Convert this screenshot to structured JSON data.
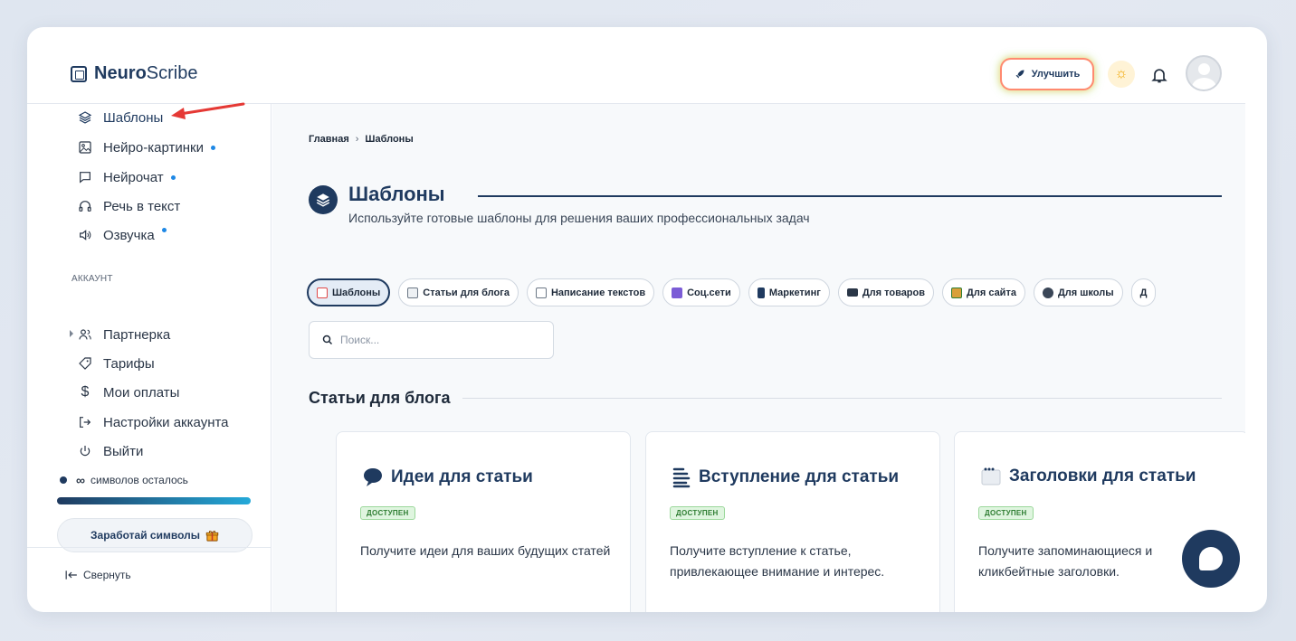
{
  "header": {
    "logo_bold": "Neuro",
    "logo_rest": "Scribe",
    "upgrade_label": "Улучшить"
  },
  "sidebar": {
    "items": [
      {
        "label": "Шаблоны",
        "icon": "layers-icon"
      },
      {
        "label": "Нейро-картинки",
        "icon": "image-icon"
      },
      {
        "label": "Нейрочат",
        "icon": "chat-bubble-icon"
      },
      {
        "label": "Речь в текст",
        "icon": "headphones-icon"
      },
      {
        "label": "Озвучка",
        "icon": "speaker-icon"
      }
    ],
    "account_label": "АККАУНТ",
    "account_items": [
      {
        "label": "Партнерка",
        "icon": "users-icon"
      },
      {
        "label": "Тарифы",
        "icon": "tag-icon"
      },
      {
        "label": "Мои оплаты",
        "icon": "dollar-icon"
      },
      {
        "label": "Настройки аккаунта",
        "icon": "settings-arrow-icon"
      },
      {
        "label": "Выйти",
        "icon": "power-icon"
      }
    ],
    "credits_symbol": "∞",
    "credits_text": "символов осталось",
    "credits_fill": 1.0,
    "earn_label": "Заработай символы",
    "collapse_label": "Свернуть"
  },
  "main": {
    "breadcrumb": [
      "Главная",
      "Шаблоны"
    ],
    "breadcrumb_sep": "›",
    "title": "Шаблоны",
    "subtitle": "Используйте готовые шаблоны для решения ваших профессиональных задач",
    "chips": [
      {
        "label": "Шаблоны",
        "active": true,
        "color": "#e04848"
      },
      {
        "label": "Статьи для блога",
        "color": "#6b7785"
      },
      {
        "label": "Написание текстов",
        "color": "#6b7785"
      },
      {
        "label": "Соц.сети",
        "color": "#7b5cd6"
      },
      {
        "label": "Маркетинг",
        "color": "#1f3a5f"
      },
      {
        "label": "Для товаров",
        "color": "#2a3647"
      },
      {
        "label": "Для сайта",
        "color": "#d9a03a"
      },
      {
        "label": "Для школы",
        "color": "#3a4657"
      },
      {
        "label": "Д",
        "color": "#6b7785"
      }
    ],
    "search_placeholder": "Поиск...",
    "section_title": "Статьи для блога",
    "cards": [
      {
        "title": "Идеи для статьи",
        "icon": "speech-bubble-icon",
        "badge": "ДОСТУПЕН",
        "desc": "Получите идеи для ваших будущих статей"
      },
      {
        "title": "Вступление для статьи",
        "icon": "text-lines-icon",
        "badge": "ДОСТУПЕН",
        "desc": "Получите вступление к статье, привлекающее внимание и интерес."
      },
      {
        "title": "Заголовки для статьи",
        "icon": "window-icon",
        "badge": "ДОСТУПЕН",
        "desc": "Получите запоминающиеся и кликбейтные заголовки."
      }
    ]
  },
  "colors": {
    "brand": "#1f3a5f",
    "accent": "#24a9d9",
    "annotation_arrow": "#e53935"
  }
}
